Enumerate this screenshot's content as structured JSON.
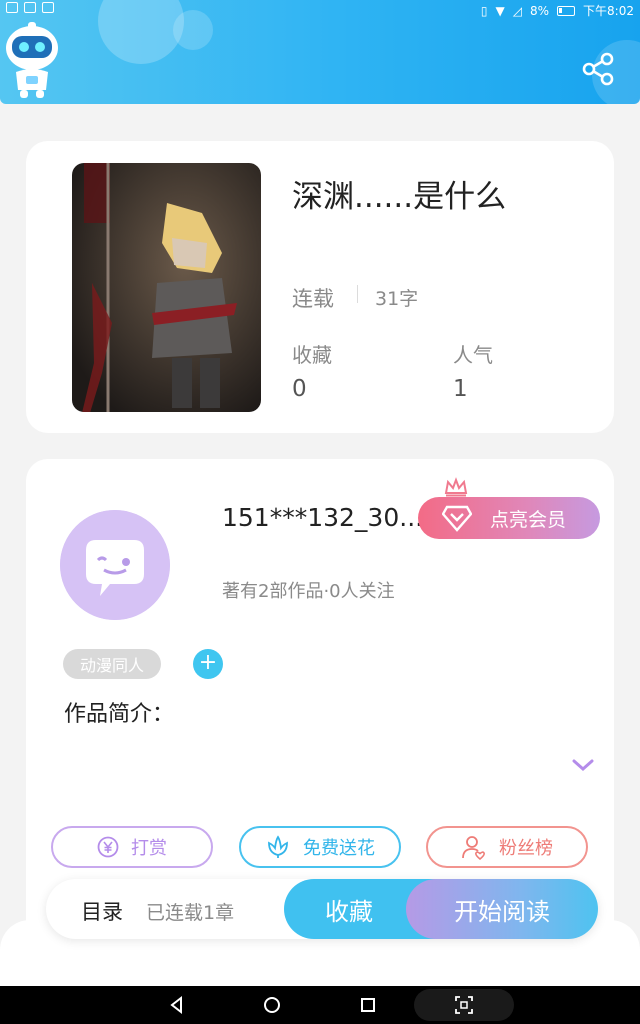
{
  "status_bar": {
    "battery": "8%",
    "time": "下午8:02"
  },
  "book": {
    "title": "深渊......是什么",
    "status": "连载",
    "word_count": "31字",
    "stats": [
      {
        "label": "收藏",
        "value": "0"
      },
      {
        "label": "人气",
        "value": "1"
      }
    ]
  },
  "author": {
    "name": "151***132_30...",
    "meta": "著有2部作品·0人关注",
    "vip_label": "点亮会员",
    "tag": "动漫同人",
    "tag_add": "+",
    "intro_label": "作品简介："
  },
  "actions": [
    {
      "label": "打赏",
      "icon": "yen-coin-icon"
    },
    {
      "label": "免费送花",
      "icon": "flower-icon"
    },
    {
      "label": "粉丝榜",
      "icon": "fans-user-icon"
    }
  ],
  "bottom_bar": {
    "toc_label": "目录",
    "chapters_label": "已连载1章",
    "favorite_label": "收藏",
    "read_label": "开始阅读"
  },
  "colors": {
    "accent_blue": "#2eb3f3",
    "purple": "#b48cea",
    "pink": "#f36b86",
    "coral": "#ee7c77"
  }
}
